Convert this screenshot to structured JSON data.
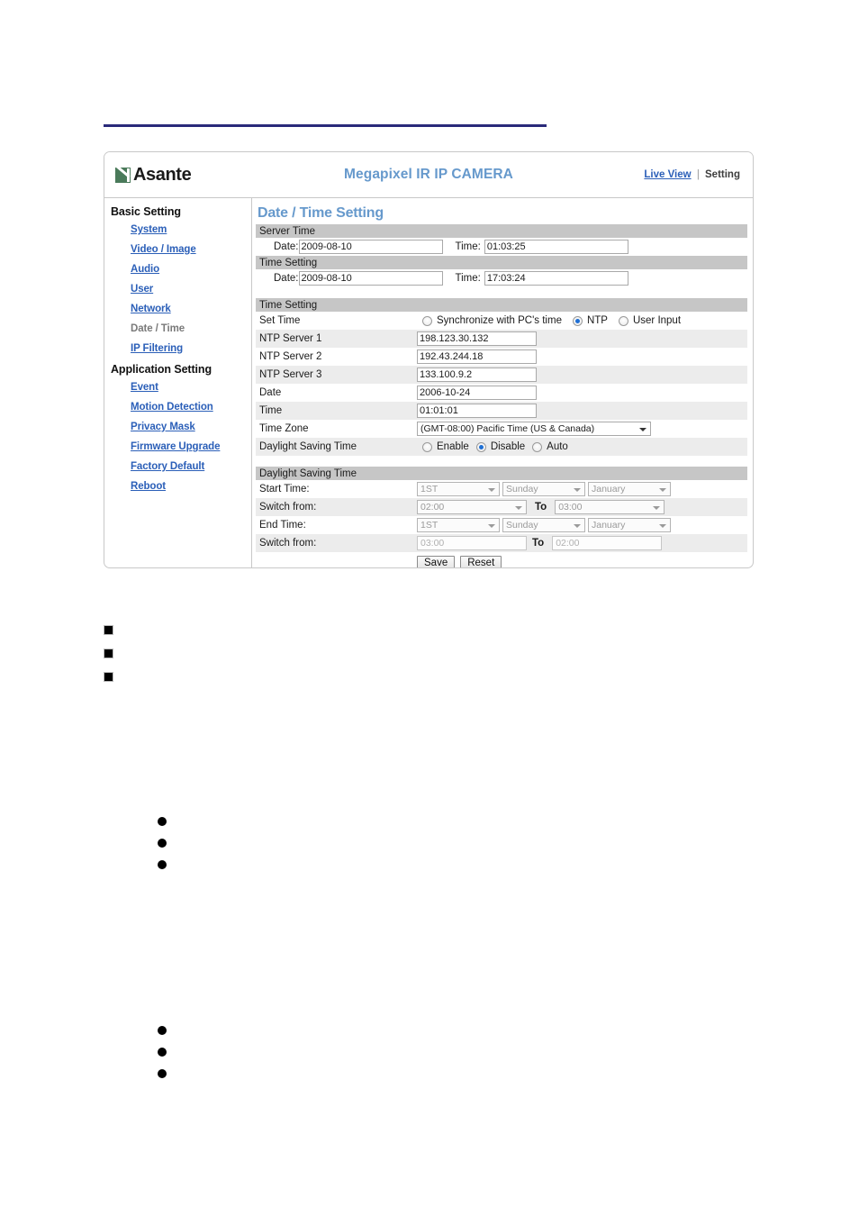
{
  "document": {
    "bullet_groups": {
      "square_bullets": [
        "",
        "",
        ""
      ],
      "round_bullets_a": [
        "",
        "",
        ""
      ],
      "round_bullets_b": [
        "",
        "",
        ""
      ]
    }
  },
  "header": {
    "logo_text": "Asante",
    "title": "Megapixel IR IP CAMERA",
    "live_view_label": "Live View",
    "separator": "|",
    "setting_label": "Setting"
  },
  "sidebar": {
    "groups": [
      {
        "label": "Basic Setting",
        "items": [
          {
            "label": "System",
            "current": false
          },
          {
            "label": "Video / Image",
            "current": false
          },
          {
            "label": "Audio",
            "current": false
          },
          {
            "label": "User",
            "current": false
          },
          {
            "label": "Network",
            "current": false
          },
          {
            "label": "Date / Time",
            "current": true
          },
          {
            "label": "IP Filtering",
            "current": false
          }
        ]
      },
      {
        "label": "Application Setting",
        "items": [
          {
            "label": "Event",
            "current": false
          },
          {
            "label": "Motion Detection",
            "current": false
          },
          {
            "label": "Privacy Mask",
            "current": false
          },
          {
            "label": "Firmware Upgrade",
            "current": false
          },
          {
            "label": "Factory Default",
            "current": false
          },
          {
            "label": "Reboot",
            "current": false
          }
        ]
      }
    ]
  },
  "main": {
    "page_title": "Date / Time Setting",
    "server_time": {
      "band": "Server Time",
      "date_label": "Date:",
      "date_value": "2009-08-10",
      "time_label": "Time:",
      "time_value": "01:03:25"
    },
    "time_setting_top": {
      "band": "Time Setting",
      "date_label": "Date:",
      "date_value": "2009-08-10",
      "time_label": "Time:",
      "time_value": "17:03:24"
    },
    "time_setting": {
      "band": "Time Setting",
      "set_time_label": "Set Time",
      "set_time_options": [
        {
          "label": "Synchronize with PC's time",
          "selected": false
        },
        {
          "label": "NTP",
          "selected": true
        },
        {
          "label": "User Input",
          "selected": false
        }
      ],
      "ntp1_label": "NTP Server 1",
      "ntp1_value": "198.123.30.132",
      "ntp2_label": "NTP Server 2",
      "ntp2_value": "192.43.244.18",
      "ntp3_label": "NTP Server 3",
      "ntp3_value": "133.100.9.2",
      "date_label": "Date",
      "date_value": "2006-10-24",
      "time_label": "Time",
      "time_value": "01:01:01",
      "timezone_label": "Time Zone",
      "timezone_value": "(GMT-08:00) Pacific Time (US & Canada)",
      "dst_label": "Daylight Saving Time",
      "dst_options": [
        {
          "label": "Enable",
          "selected": false
        },
        {
          "label": "Disable",
          "selected": true
        },
        {
          "label": "Auto",
          "selected": false
        }
      ]
    },
    "daylight_saving": {
      "band": "Daylight Saving Time",
      "start_time_label": "Start Time:",
      "start_ordinal": "1ST",
      "start_weekday": "Sunday",
      "start_month": "January",
      "switch_from_label_1": "Switch from:",
      "switch_from_1": "02:00",
      "to_label_1": "To",
      "switch_to_1": "03:00",
      "end_time_label": "End Time:",
      "end_ordinal": "1ST",
      "end_weekday": "Sunday",
      "end_month": "January",
      "switch_from_label_2": "Switch from:",
      "switch_from_2": "03:00",
      "to_label_2": "To",
      "switch_to_2": "02:00"
    },
    "buttons": {
      "save_label": "Save",
      "reset_label": "Reset"
    }
  }
}
